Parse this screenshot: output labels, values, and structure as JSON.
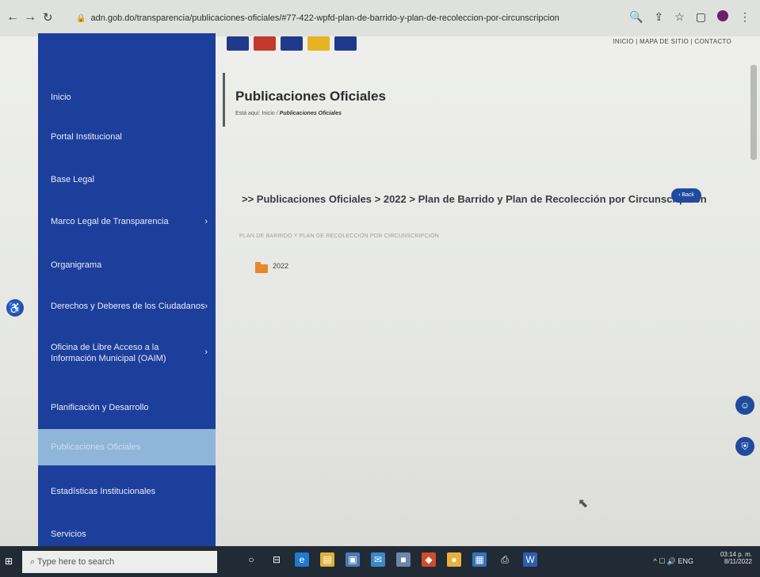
{
  "browser": {
    "url": "adn.gob.do/transparencia/publicaciones-oficiales/#77-422-wpfd-plan-de-barrido-y-plan-de-recoleccion-por-circunscripcion"
  },
  "header": {
    "top_links": "INICIO | MAPA DE SITIO | CONTACTO"
  },
  "sidebar": {
    "items": [
      {
        "label": "Inicio"
      },
      {
        "label": "Portal Institucional"
      },
      {
        "label": "Base Legal"
      },
      {
        "label": "Marco Legal de Transparencia"
      },
      {
        "label": "Organigrama"
      },
      {
        "label": "Derechos y Deberes de los Ciudadanos"
      },
      {
        "label": "Oficina de Libre Acceso a la Información Municipal (OAIM)"
      },
      {
        "label": "Planificación y Desarrollo"
      },
      {
        "label": "Publicaciones Oficiales"
      },
      {
        "label": "Estadísticas Institucionales"
      },
      {
        "label": "Servicios"
      }
    ]
  },
  "main": {
    "title": "Publicaciones Oficiales",
    "breadcrumb_prefix": "Está aquí: Inicio /",
    "breadcrumb_current": "Publicaciones Oficiales",
    "path_heading": ">> Publicaciones Oficiales  > 2022  > Plan de Barrido y Plan de Recolección por Circunscripción",
    "back_label": "‹ Back",
    "category_caption": "PLAN DE BARRIDO Y PLAN DE RECOLECCIÓN POR CIRCUNSCRIPCIÓN",
    "folder_label": "2022"
  },
  "taskbar": {
    "search_placeholder": "Type here to search",
    "language": "ENG",
    "time": "03:14 p. m.",
    "date": "8/11/2022"
  },
  "colors": {
    "sidebar": "#1d3f9c",
    "active_item": "#8fb6d8",
    "folder": "#e7862b",
    "accent": "#1f4a9e"
  }
}
